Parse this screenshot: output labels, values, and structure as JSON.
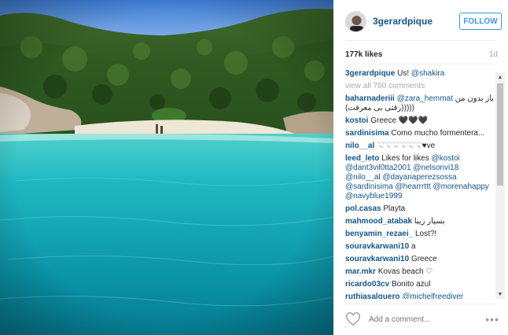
{
  "post": {
    "username": "3gerardpique",
    "follow_label": "FOLLOW",
    "likes": "177k likes",
    "time": "1d",
    "caption": {
      "user": "3gerardpique",
      "text": "Us! ",
      "mention": "@shakira"
    },
    "view_all": "view all 700 comments"
  },
  "comments": [
    {
      "user": "baharnaderiii",
      "text": "",
      "mention": "@zara_hemmat",
      "tail": " باز بدون من (رقتی بی معرفت)))))"
    },
    {
      "user": "kostoi",
      "text": "Greece 🖤🖤🖤"
    },
    {
      "user": "sardinisima",
      "text": "Como mucho formentera..."
    },
    {
      "user": "nilo__al",
      "text": "𓇢𓇢𓇢𓇢𓇢𓇢♥ve"
    },
    {
      "user": "leed_leto",
      "text": "Likes for likes ",
      "mention": "@kostoi @dant3vil0tta2001 @nelsonvi18 @nilo__al @dayanaperezsossa @sardinisima @hearrrttt @morenahappy @navyblue1999"
    },
    {
      "user": "pol.casas",
      "text": "Playta"
    },
    {
      "user": "mahmood_atabak",
      "text": "بسیار زیبا"
    },
    {
      "user": "benyamin_rezaei_",
      "text": "Lost?!"
    },
    {
      "user": "souravkarwani10",
      "text": "a"
    },
    {
      "user": "souravkarwani10",
      "text": "Greece"
    },
    {
      "user": "mar.mkr",
      "text": "Kovas beach ♡"
    },
    {
      "user": "ricardo03cv",
      "text": "Bonito azul"
    },
    {
      "user": "ruthiasalguero",
      "text": "",
      "mention": "@michelfreediver"
    }
  ],
  "add_comment": {
    "placeholder": "Add a comment..."
  },
  "icons": {
    "like": "heart-icon",
    "more": "more-options-icon",
    "scroll_up": "arrow-up-icon",
    "scroll_down": "arrow-down-icon"
  },
  "colors": {
    "link": "#125688",
    "follow": "#3897f0",
    "muted": "#a5a7aa"
  }
}
